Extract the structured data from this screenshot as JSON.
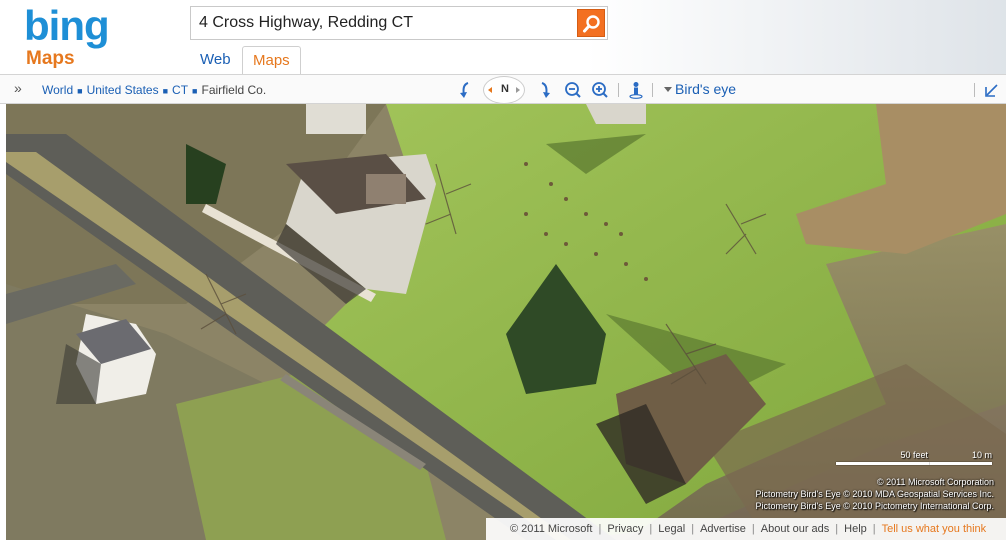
{
  "brand": {
    "logo": "bing",
    "product": "Maps"
  },
  "search": {
    "value": "4 Cross Highway, Redding CT",
    "button_icon": "search-icon"
  },
  "tabs": [
    {
      "label": "Web"
    },
    {
      "label": "Maps",
      "active": true
    }
  ],
  "toolbar": {
    "breadcrumbs": [
      "World",
      "United States",
      "CT"
    ],
    "current": "Fairfield Co.",
    "compass": "N",
    "view_mode": "Bird's eye",
    "icons": [
      "expand-icon",
      "rotate-left-icon",
      "compass-icon",
      "rotate-right-icon",
      "zoom-out-icon",
      "zoom-in-icon",
      "streetside-person-icon",
      "birdseye-dropdown-icon",
      "collapse-arrow-icon"
    ]
  },
  "map": {
    "scale_feet": "50 feet",
    "scale_meters": "10 m",
    "copyright": [
      "© 2011 Microsoft Corporation",
      "Pictometry Bird's Eye © 2010 MDA Geospatial Services Inc.",
      "Pictometry Bird's Eye © 2010 Pictometry International Corp."
    ]
  },
  "footer": {
    "copyright": "© 2011 Microsoft",
    "links": [
      "Privacy",
      "Legal",
      "Advertise",
      "About our ads",
      "Help"
    ],
    "feedback": "Tell us what you think"
  },
  "colors": {
    "brand_blue": "#1e8fd6",
    "accent_orange": "#e6781e",
    "link_blue": "#1a5fb4",
    "lawn_green": "#8fb44a"
  }
}
